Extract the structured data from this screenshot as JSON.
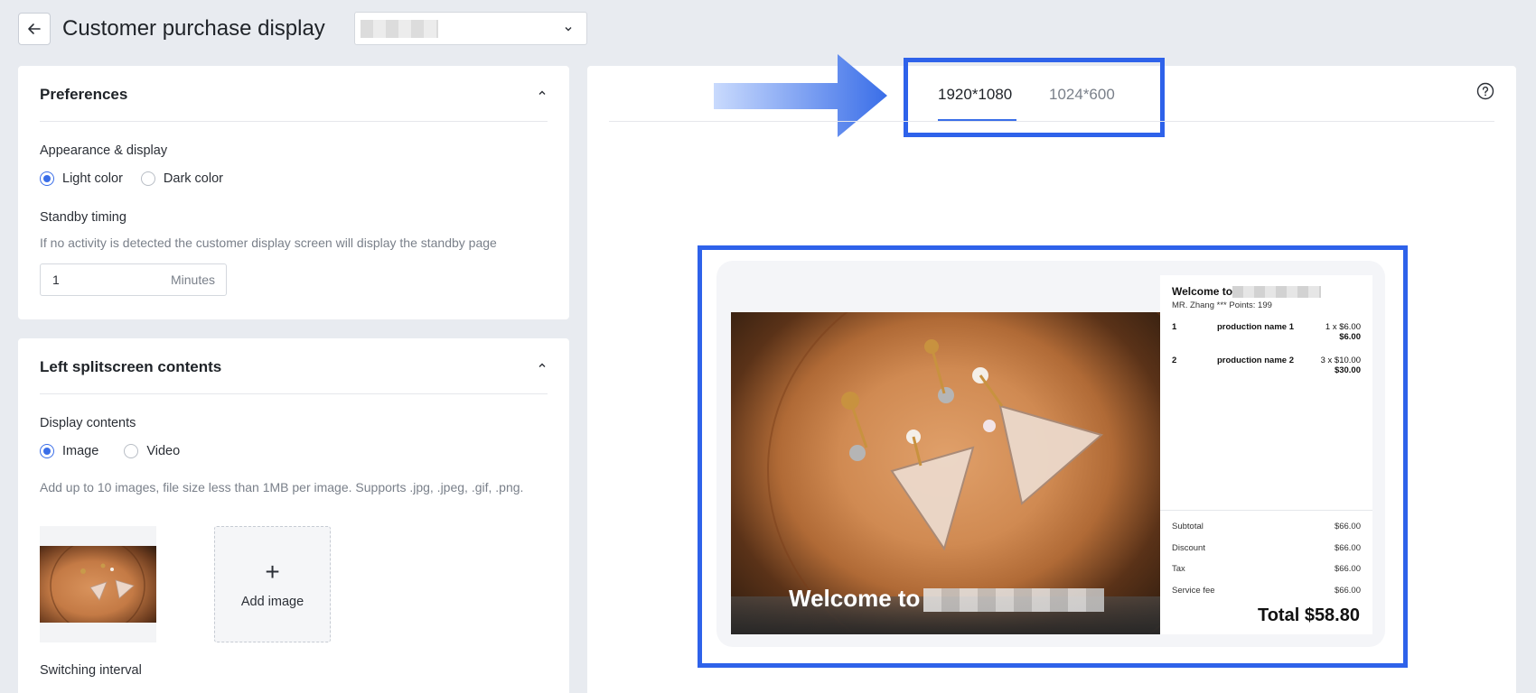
{
  "header": {
    "title": "Customer purchase display",
    "store_select_value": ""
  },
  "preferences": {
    "title": "Preferences",
    "appearance_label": "Appearance & display",
    "appearance_options": [
      "Light color",
      "Dark color"
    ],
    "appearance_selected": "Light color",
    "standby_label": "Standby timing",
    "standby_hint": "If no activity is detected the customer display screen will display the standby page",
    "standby_value": "1",
    "standby_unit": "Minutes"
  },
  "left_split": {
    "title": "Left splitscreen contents",
    "display_label": "Display contents",
    "display_options": [
      "Image",
      "Video"
    ],
    "display_selected": "Image",
    "image_hint": "Add up to 10 images, file size less than 1MB per image. Supports .jpg, .jpeg, .gif, .png.",
    "add_image_label": "Add image",
    "switching_label": "Switching interval"
  },
  "preview": {
    "tabs": [
      "1920*1080",
      "1024*600"
    ],
    "active_tab": "1920*1080",
    "photo_welcome": "Welcome to",
    "receipt": {
      "welcome": "Welcome to",
      "customer": "MR. Zhang *** Points: 199",
      "items": [
        {
          "index": "1",
          "name": "production name 1",
          "qty": "1 x $6.00",
          "amount": "$6.00"
        },
        {
          "index": "2",
          "name": "production name 2",
          "qty": "3 x $10.00",
          "amount": "$30.00"
        }
      ],
      "summary": [
        {
          "label": "Subtotal",
          "value": "$66.00"
        },
        {
          "label": "Discount",
          "value": "$66.00"
        },
        {
          "label": "Tax",
          "value": "$66.00"
        },
        {
          "label": "Service fee",
          "value": "$66.00"
        }
      ],
      "total": "Total $58.80"
    }
  },
  "colors": {
    "accent": "#3a6ee8",
    "highlight": "#2e62ea",
    "background": "#e8ebf0"
  },
  "icons": [
    "back-arrow-icon",
    "chevron-down-icon",
    "chevron-up-icon",
    "help-icon",
    "plus-icon",
    "pointer-arrow"
  ]
}
